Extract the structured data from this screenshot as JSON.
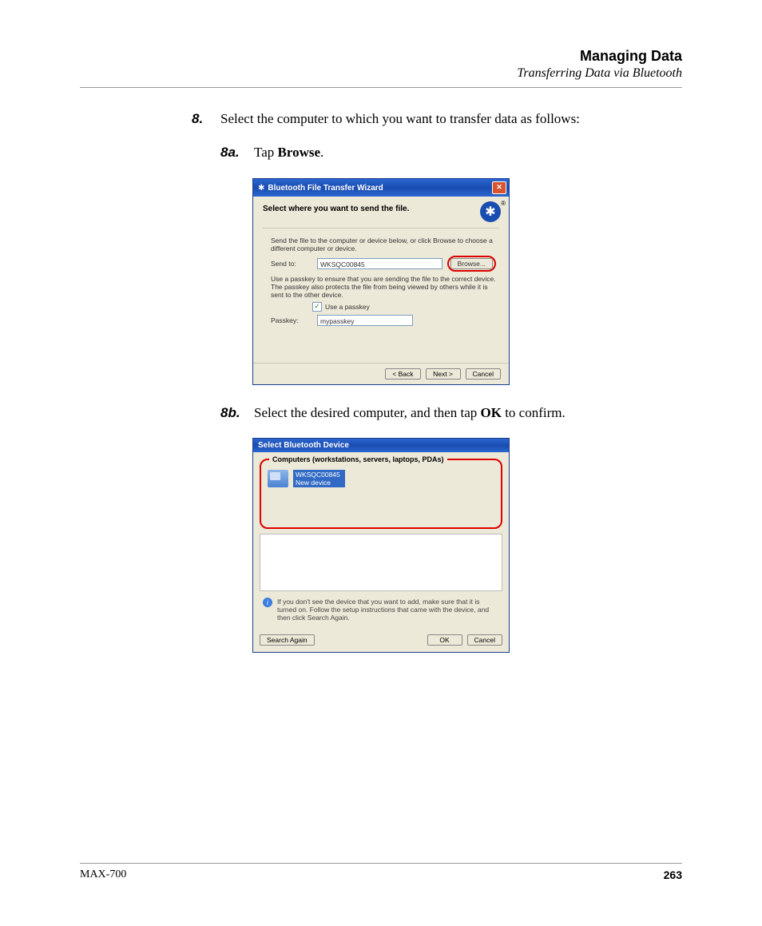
{
  "header": {
    "title": "Managing Data",
    "subtitle": "Transferring Data via Bluetooth"
  },
  "step8": {
    "num": "8.",
    "text": "Select the computer to which you want to transfer data as follows:"
  },
  "step8a": {
    "num": "8a.",
    "prefix": "Tap ",
    "bold": "Browse",
    "suffix": "."
  },
  "step8b": {
    "num": "8b.",
    "prefix": "Select the desired computer, and then tap ",
    "bold": "OK",
    "suffix": " to confirm."
  },
  "dialog1": {
    "title": "Bluetooth File Transfer Wizard",
    "heading": "Select where you want to send the file.",
    "desc": "Send the file to the computer or device below, or click Browse to choose a different computer or device.",
    "sendto_label": "Send to:",
    "sendto_value": "WKSQC00845",
    "browse": "Browse...",
    "passkey_note": "Use a passkey to ensure that you are sending the file to the correct device. The passkey also protects the file from being viewed by others while it is sent to the other device.",
    "use_passkey": "Use a passkey",
    "passkey_label": "Passkey:",
    "passkey_value": "mypasskey",
    "back": "< Back",
    "next": "Next >",
    "cancel": "Cancel"
  },
  "dialog2": {
    "title": "Select Bluetooth Device",
    "group": "Computers (workstations, servers, laptops, PDAs)",
    "device_name": "WKSQC00845",
    "device_status": "New device",
    "info": "If you don't see the device that you want to add, make sure that it is turned on. Follow the setup instructions that came with the device, and then click Search Again.",
    "search": "Search Again",
    "ok": "OK",
    "cancel": "Cancel"
  },
  "footer": {
    "left": "MAX-700",
    "right": "263"
  }
}
